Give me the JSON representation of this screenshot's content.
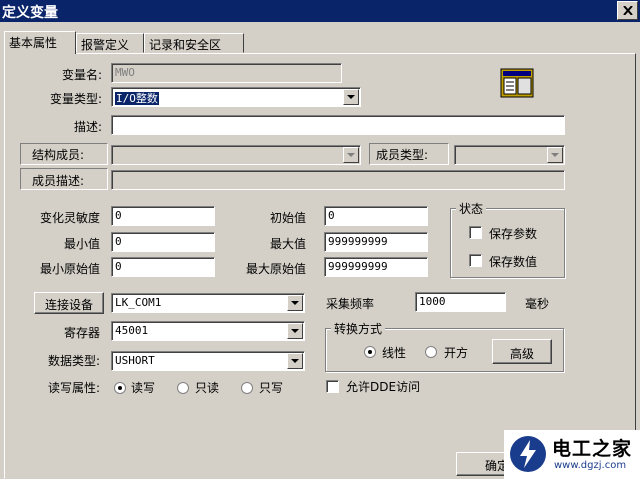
{
  "window": {
    "title": "定义变量"
  },
  "tabs": [
    {
      "label": "基本属性"
    },
    {
      "label": "报警定义"
    },
    {
      "label": "记录和安全区"
    }
  ],
  "form": {
    "var_name": {
      "label": "变量名:",
      "value": "MWO"
    },
    "var_type": {
      "label": "变量类型:",
      "value": "I/O整数"
    },
    "desc": {
      "label": "描述:",
      "value": ""
    },
    "struct_member": {
      "label": "结构成员:",
      "value": ""
    },
    "member_type": {
      "label": "成员类型:",
      "value": ""
    },
    "member_desc": {
      "label": "成员描述:",
      "value": ""
    },
    "sensitivity": {
      "label": "变化灵敏度",
      "value": "0"
    },
    "initial": {
      "label": "初始值",
      "value": "0"
    },
    "min": {
      "label": "最小值",
      "value": "0"
    },
    "max": {
      "label": "最大值",
      "value": "999999999"
    },
    "min_raw": {
      "label": "最小原始值",
      "value": "0"
    },
    "max_raw": {
      "label": "最大原始值",
      "value": "999999999"
    },
    "state": {
      "title": "状态",
      "save_params": "保存参数",
      "save_values": "保存数值"
    },
    "connect": {
      "button": "连接设备",
      "value": "LK_COM1"
    },
    "sample": {
      "label": "采集频率",
      "value": "1000",
      "unit": "毫秒"
    },
    "register": {
      "label": "寄存器",
      "value": "45001"
    },
    "data_type": {
      "label": "数据类型:",
      "value": "USHORT"
    },
    "conversion": {
      "title": "转换方式",
      "linear": "线性",
      "sqrt": "开方",
      "advanced": "高级"
    },
    "rw": {
      "label": "读写属性:",
      "readwrite": "读写",
      "readonly": "只读",
      "writeonly": "只写"
    },
    "dde": {
      "label": "允许DDE访问"
    }
  },
  "footer": {
    "ok": "确定"
  },
  "watermark": {
    "name": "电工之家",
    "url": "www.dgzj.com"
  }
}
